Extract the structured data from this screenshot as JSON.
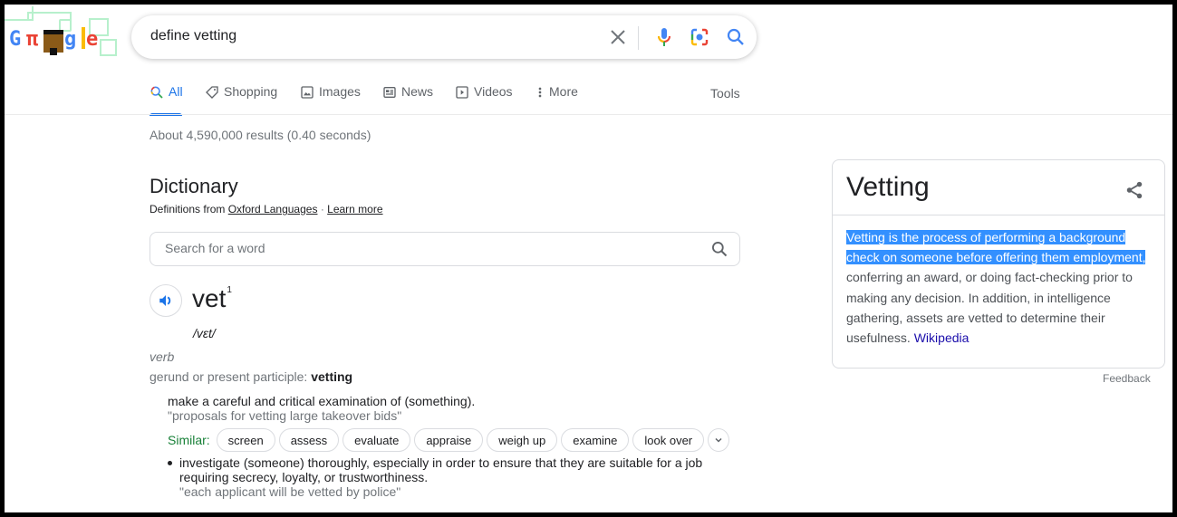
{
  "logo": {
    "letters": [
      "G",
      "π",
      "",
      "g",
      "l",
      "e"
    ],
    "alt": "Google doodle"
  },
  "search": {
    "query": "define vetting",
    "icons": [
      "clear-icon",
      "microphone-icon",
      "camera-lens-icon",
      "search-icon"
    ]
  },
  "tabs": [
    {
      "label": "All",
      "icon": "search-icon",
      "active": true
    },
    {
      "label": "Shopping",
      "icon": "tag-icon"
    },
    {
      "label": "Images",
      "icon": "image-icon"
    },
    {
      "label": "News",
      "icon": "newspaper-icon"
    },
    {
      "label": "Videos",
      "icon": "play-icon"
    },
    {
      "label": "More",
      "icon": "more-vert-icon"
    }
  ],
  "tools_label": "Tools",
  "result_stats": "About 4,590,000 results (0.40 seconds)",
  "dictionary": {
    "title": "Dictionary",
    "source_prefix": "Definitions from",
    "source_link": "Oxford Languages",
    "separator": "·",
    "learn_more": "Learn more",
    "search_placeholder": "Search for a word",
    "word": "vet",
    "word_sup": "1",
    "phonetic": "/vɛt/",
    "part_of_speech": "verb",
    "forms_label": "gerund or present participle:",
    "forms_value": "vetting",
    "definitions": [
      {
        "text": "make a careful and critical examination of (something).",
        "example": "\"proposals for vetting large takeover bids\"",
        "similar_label": "Similar:",
        "similar": [
          "screen",
          "assess",
          "evaluate",
          "appraise",
          "weigh up",
          "examine",
          "look over"
        ]
      },
      {
        "text": "investigate (someone) thoroughly, especially in order to ensure that they are suitable for a job requiring secrecy, loyalty, or trustworthiness.",
        "example": "\"each applicant will be vetted by police\""
      }
    ]
  },
  "knowledge_panel": {
    "title": "Vetting",
    "description_highlighted": "Vetting is the process of performing a background check on someone before offering them employment,",
    "description_rest": " conferring an award, or doing fact-checking prior to making any decision. In addition, in intelligence gathering, assets are vetted to determine their usefulness.",
    "source_link": "Wikipedia",
    "feedback": "Feedback"
  },
  "colors": {
    "accent": "#1a73e8",
    "link": "#1a0dab",
    "similar_label": "#188038",
    "selection": "#3390ff"
  }
}
